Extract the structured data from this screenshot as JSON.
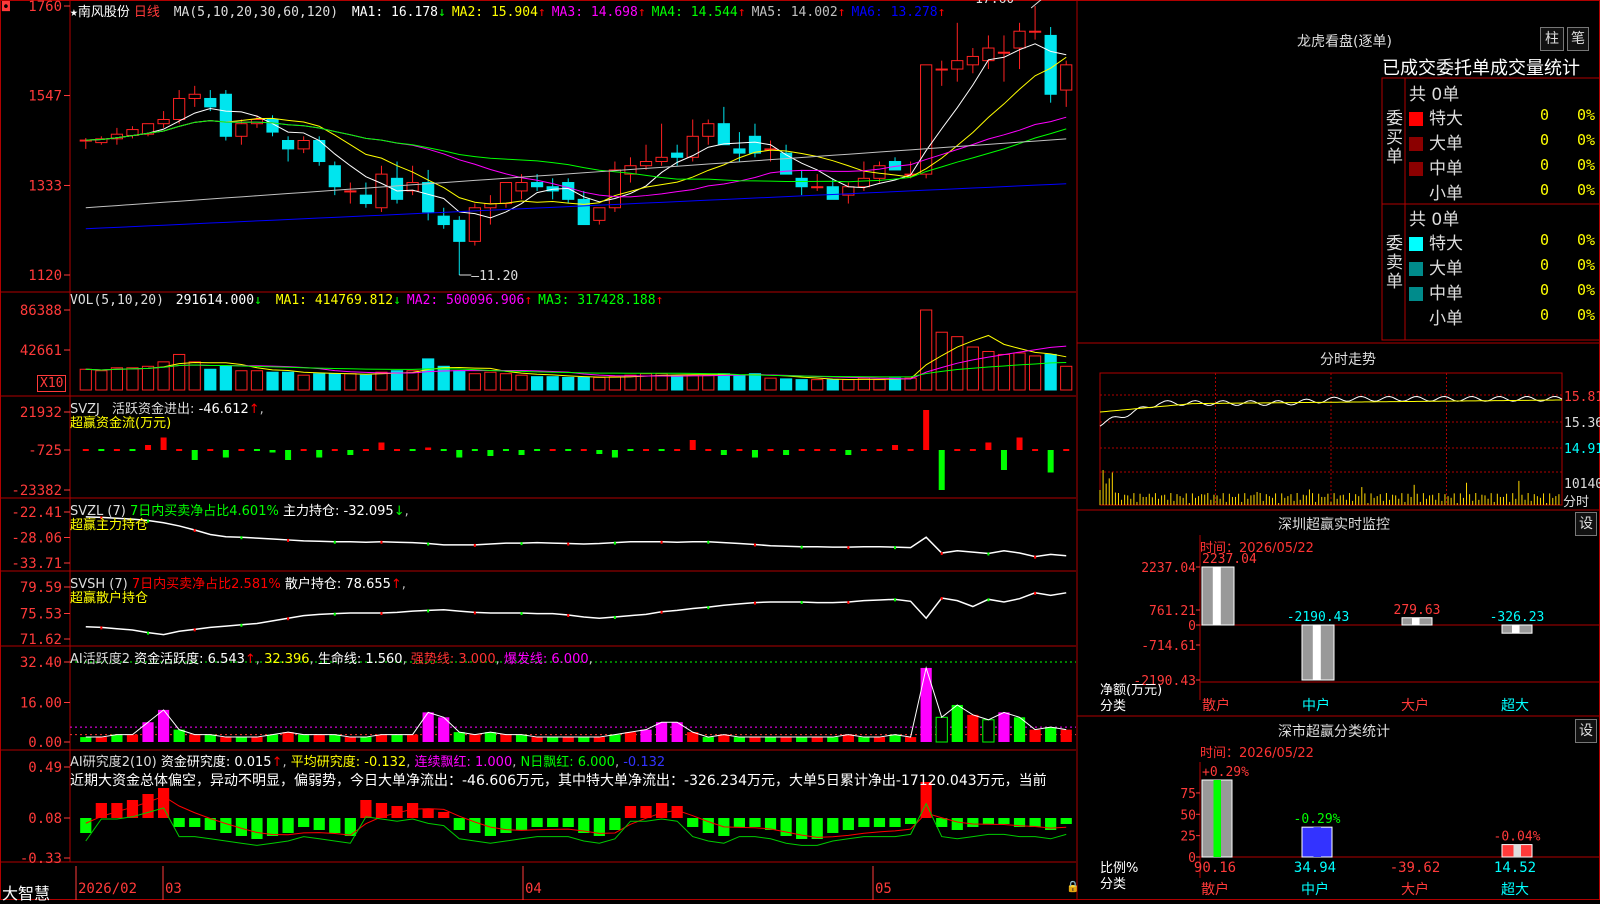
{
  "stock": {
    "star": "★",
    "name": "南风股份",
    "period": "日线"
  },
  "colors": {
    "up": "#ff2222",
    "down": "#00e5ee",
    "bg": "#000000",
    "frame": "#b00000",
    "grid": "#7a0000",
    "ma1": "#ffffff",
    "ma2": "#ffff00",
    "ma3": "#ff00ff",
    "ma4": "#00ff00",
    "ma5": "#c0c0c0",
    "ma6": "#0000ff",
    "buyBig": "#ff0000",
    "buyL": "#8b0000",
    "sellBig": "#00ffff",
    "sellL": "#008b8b"
  },
  "main": {
    "ma_label": "MA(5,10,20,30,60,120)",
    "ma": [
      {
        "label": "MA1:",
        "value": "16.178",
        "arrow": "↓",
        "color": "#ffffff"
      },
      {
        "label": "MA2:",
        "value": "15.904",
        "arrow": "↑",
        "color": "#ffff00"
      },
      {
        "label": "MA3:",
        "value": "14.698",
        "arrow": "↑",
        "color": "#ff00ff"
      },
      {
        "label": "MA4:",
        "value": "14.544",
        "arrow": "↑",
        "color": "#00ff00"
      },
      {
        "label": "MA5:",
        "value": "14.002",
        "arrow": "↑",
        "color": "#c0c0c0"
      },
      {
        "label": "MA6:",
        "value": "13.278",
        "arrow": "↑",
        "color": "#0000ff"
      }
    ],
    "yticks": [
      "1760",
      "1547",
      "1333",
      "1120"
    ],
    "high_label": "17.60",
    "low_label": "11.20",
    "ylim": [
      11.2,
      17.6
    ],
    "candles": [
      [
        14.41,
        14.46,
        14.2,
        14.41
      ],
      [
        14.35,
        14.5,
        14.3,
        14.44
      ],
      [
        14.44,
        14.7,
        14.3,
        14.55
      ],
      [
        14.52,
        14.74,
        14.45,
        14.66
      ],
      [
        14.55,
        14.75,
        14.5,
        14.8
      ],
      [
        14.8,
        15.1,
        14.7,
        14.9
      ],
      [
        14.9,
        15.6,
        14.8,
        15.4
      ],
      [
        15.4,
        15.7,
        15.2,
        15.5
      ],
      [
        15.4,
        15.6,
        15.1,
        15.2
      ],
      [
        15.5,
        15.6,
        14.4,
        14.5
      ],
      [
        14.5,
        14.9,
        14.3,
        14.8
      ],
      [
        14.8,
        15.0,
        14.7,
        14.9
      ],
      [
        14.9,
        15.0,
        14.5,
        14.6
      ],
      [
        14.4,
        14.5,
        13.9,
        14.2
      ],
      [
        14.2,
        14.5,
        14.1,
        14.4
      ],
      [
        14.4,
        14.5,
        13.8,
        13.9
      ],
      [
        13.8,
        13.9,
        13.1,
        13.3
      ],
      [
        13.2,
        13.4,
        12.9,
        13.2
      ],
      [
        13.1,
        13.4,
        12.8,
        12.9
      ],
      [
        12.8,
        13.8,
        12.7,
        13.6
      ],
      [
        13.5,
        13.9,
        12.9,
        13.0
      ],
      [
        13.2,
        13.8,
        13.1,
        13.4
      ],
      [
        13.4,
        13.7,
        12.5,
        12.7
      ],
      [
        12.6,
        12.8,
        12.3,
        12.4
      ],
      [
        12.5,
        12.6,
        11.2,
        12.0
      ],
      [
        12.0,
        12.9,
        11.9,
        12.8
      ],
      [
        12.8,
        13.1,
        12.4,
        12.9
      ],
      [
        12.9,
        13.4,
        12.8,
        13.4
      ],
      [
        13.2,
        13.6,
        13.0,
        13.4
      ],
      [
        13.4,
        13.6,
        13.2,
        13.3
      ],
      [
        13.3,
        13.5,
        13.0,
        13.2
      ],
      [
        13.4,
        13.5,
        12.9,
        13.0
      ],
      [
        13.0,
        13.2,
        12.4,
        12.4
      ],
      [
        12.5,
        12.8,
        12.4,
        12.8
      ],
      [
        12.8,
        13.9,
        12.7,
        13.7
      ],
      [
        13.6,
        14.0,
        13.4,
        13.8
      ],
      [
        13.8,
        14.3,
        13.7,
        13.9
      ],
      [
        13.9,
        14.8,
        13.8,
        14.0
      ],
      [
        14.1,
        14.3,
        13.8,
        14.0
      ],
      [
        14.0,
        14.9,
        13.9,
        14.5
      ],
      [
        14.5,
        14.9,
        14.3,
        14.8
      ],
      [
        14.8,
        15.2,
        14.3,
        14.3
      ],
      [
        14.2,
        14.6,
        13.9,
        14.1
      ],
      [
        14.5,
        14.8,
        14.0,
        14.1
      ],
      [
        14.2,
        14.4,
        13.9,
        14.2
      ],
      [
        14.1,
        14.3,
        13.6,
        13.6
      ],
      [
        13.5,
        13.7,
        13.1,
        13.3
      ],
      [
        13.3,
        13.6,
        13.2,
        13.3
      ],
      [
        13.3,
        13.5,
        13.0,
        13.0
      ],
      [
        13.1,
        13.4,
        12.9,
        13.3
      ],
      [
        13.3,
        13.9,
        13.2,
        13.5
      ],
      [
        13.5,
        13.9,
        13.4,
        13.8
      ],
      [
        13.9,
        14.0,
        13.7,
        13.7
      ],
      [
        13.6,
        13.9,
        13.5,
        13.6
      ],
      [
        13.6,
        16.2,
        13.5,
        16.2
      ],
      [
        16.1,
        16.3,
        15.7,
        16.1
      ],
      [
        16.1,
        17.2,
        15.8,
        16.3
      ],
      [
        16.2,
        16.6,
        16.0,
        16.4
      ],
      [
        16.3,
        16.9,
        16.1,
        16.6
      ],
      [
        16.5,
        16.9,
        15.8,
        16.5
      ],
      [
        16.6,
        17.2,
        16.1,
        17.0
      ],
      [
        17.0,
        17.6,
        16.8,
        17.0
      ],
      [
        16.9,
        17.1,
        15.3,
        15.5
      ],
      [
        15.6,
        16.3,
        15.2,
        16.2
      ]
    ]
  },
  "vol": {
    "label": "VOL(5,10,20)",
    "value": "291614.000",
    "arrow": "↓",
    "ma": [
      {
        "label": "MA1:",
        "value": "414769.812",
        "arrow": "↓",
        "color": "#ffff00"
      },
      {
        "label": "MA2:",
        "value": "500096.906",
        "arrow": "↑",
        "color": "#ff00ff"
      },
      {
        "label": "MA3:",
        "value": "317428.188",
        "arrow": "↑",
        "color": "#00ff00"
      }
    ],
    "yticks": [
      "86388",
      "42661"
    ],
    "unit": "X10",
    "values": [
      140,
      130,
      150,
      150,
      160,
      190,
      240,
      190,
      140,
      160,
      130,
      130,
      120,
      120,
      100,
      110,
      110,
      110,
      100,
      120,
      130,
      130,
      210,
      160,
      130,
      110,
      120,
      110,
      100,
      90,
      90,
      85,
      85,
      85,
      90,
      100,
      110,
      110,
      95,
      100,
      100,
      110,
      100,
      110,
      80,
      75,
      70,
      70,
      70,
      70,
      80,
      70,
      80,
      80,
      540,
      390,
      360,
      290,
      260,
      240,
      250,
      230,
      240,
      160
    ]
  },
  "svzj": {
    "label": "SVZJ",
    "name": "活跃资金进出:",
    "value": "-46.612",
    "arrow": "↑",
    "sub": "超赢资金流(万元)",
    "yticks": [
      "21932",
      "-725",
      "-23382"
    ],
    "values": [
      0,
      0,
      0,
      0,
      10,
      25,
      0,
      -20,
      0,
      -15,
      0,
      0,
      -5,
      -20,
      0,
      -15,
      0,
      -10,
      0,
      15,
      0,
      0,
      5,
      0,
      -15,
      0,
      -12,
      0,
      -10,
      0,
      0,
      0,
      0,
      -8,
      -15,
      0,
      0,
      0,
      0,
      20,
      0,
      -10,
      0,
      -15,
      0,
      -10,
      0,
      0,
      0,
      -10,
      0,
      0,
      10,
      0,
      80,
      -80,
      0,
      0,
      15,
      -40,
      25,
      0,
      -45,
      0
    ]
  },
  "svzl": {
    "label": "SVZL (7)",
    "mid": "7日内买卖净占比4.601%",
    "main_label": "主力持仓:",
    "main_value": "-32.095",
    "arrow": "↓",
    "sub": "超赢主力持仓",
    "yticks": [
      "-22.41",
      "-28.06",
      "-33.71"
    ],
    "values": [
      -23.5,
      -23.6,
      -23.8,
      -24.0,
      -24.3,
      -24.8,
      -25.5,
      -26.4,
      -27.4,
      -27.9,
      -28.0,
      -28.2,
      -28.4,
      -28.6,
      -28.8,
      -28.9,
      -29.0,
      -29.0,
      -29.1,
      -29.0,
      -29.1,
      -29.2,
      -29.4,
      -29.7,
      -29.7,
      -29.7,
      -29.5,
      -29.3,
      -29.3,
      -29.2,
      -29.3,
      -29.4,
      -29.5,
      -29.4,
      -29.2,
      -29.0,
      -29.0,
      -29.0,
      -29.1,
      -29.0,
      -29.0,
      -29.2,
      -29.4,
      -29.6,
      -29.9,
      -30.0,
      -30.1,
      -30.1,
      -30.2,
      -30.2,
      -30.1,
      -30.1,
      -30.2,
      -30.3,
      -28.0,
      -31.5,
      -31.0,
      -31.3,
      -31.6,
      -31.0,
      -31.5,
      -32.3,
      -31.8,
      -32.1
    ]
  },
  "svsh": {
    "label": "SVSH (7)",
    "mid": "7日内买卖净占比2.581%",
    "main_label": "散户持仓:",
    "main_value": "78.655",
    "arrow": "↑",
    "sub": "超赢散户持仓",
    "yticks": [
      "79.59",
      "75.53",
      "71.62"
    ],
    "values": [
      73.5,
      73.4,
      73.2,
      73.0,
      72.6,
      72.3,
      72.8,
      73.1,
      73.4,
      73.6,
      73.8,
      74.0,
      74.4,
      74.8,
      75.2,
      75.4,
      75.5,
      75.6,
      75.6,
      75.6,
      75.7,
      75.9,
      76.0,
      76.1,
      75.9,
      75.7,
      75.6,
      75.6,
      75.6,
      75.5,
      75.5,
      75.3,
      75.0,
      74.8,
      75.0,
      75.2,
      75.4,
      75.8,
      76.0,
      76.3,
      76.5,
      76.8,
      77.0,
      77.2,
      77.3,
      77.3,
      77.3,
      77.2,
      77.2,
      77.3,
      77.5,
      77.6,
      77.7,
      77.4,
      74.8,
      77.9,
      77.5,
      76.6,
      77.7,
      77.3,
      77.8,
      78.7,
      78.3,
      78.7
    ]
  },
  "ai_act": {
    "label": "AI活跃度2",
    "name": "资金活跃度:",
    "value": "6.543",
    "arrow": "↑",
    "v2": "32.396",
    "life_label": "生命线:",
    "life": "1.560",
    "strong_label": "强势线:",
    "strong": "3.000",
    "burst_label": "爆发线:",
    "burst": "6.000",
    "yticks": [
      "32.40",
      "16.00",
      "0.00"
    ],
    "values": [
      2,
      2,
      3,
      3,
      8,
      13,
      5,
      3,
      3,
      2,
      2,
      2,
      3,
      4,
      3,
      3,
      3,
      2,
      2,
      3,
      3,
      3,
      12,
      10,
      4,
      3,
      4,
      3,
      3,
      2,
      2,
      2,
      2,
      2,
      3,
      4,
      5,
      8,
      8,
      4,
      2,
      3,
      2,
      2,
      2,
      2,
      2,
      2,
      2,
      3,
      2,
      2,
      3,
      2,
      30,
      10,
      15,
      11,
      9,
      12,
      10,
      5,
      6,
      5
    ],
    "flags": [
      0,
      0,
      0,
      0,
      1,
      1,
      0,
      0,
      0,
      0,
      0,
      0,
      0,
      0,
      0,
      0,
      0,
      0,
      0,
      0,
      0,
      0,
      1,
      1,
      0,
      0,
      0,
      0,
      0,
      0,
      0,
      0,
      0,
      0,
      0,
      0,
      1,
      1,
      1,
      0,
      0,
      0,
      0,
      0,
      0,
      0,
      0,
      0,
      0,
      0,
      0,
      0,
      0,
      0,
      1,
      0,
      0,
      0,
      1,
      1,
      0,
      0,
      0,
      0
    ]
  },
  "ai_res": {
    "label": "AI研究度2(10)",
    "name": "资金研究度:",
    "value": "0.015",
    "arrow": "↑",
    "avg_label": "平均研究度:",
    "avg": "-0.132",
    "red_label": "连续飘红:",
    "red": "1.000",
    "n_label": "N日飘红:",
    "n": "6.000",
    "last": "-0.132",
    "comment": "近期大资金总体偏空，异动不明显，偏弱势，今日大单净流出：-46.606万元，其中特大单净流出：-326.234万元，大单5日累计净出-17120.043万元，当前",
    "yticks": [
      "0.49",
      "0.08",
      "-0.33"
    ],
    "values": [
      -5,
      5,
      5,
      6,
      8,
      10,
      -3,
      -3,
      -4,
      -5,
      -6,
      -7,
      -6,
      -5,
      -3,
      -4,
      -5,
      -6,
      6,
      5,
      4,
      5,
      3,
      2,
      -4,
      -5,
      -6,
      -5,
      -4,
      -3,
      -3,
      -3,
      -5,
      -6,
      -4,
      4,
      4,
      5,
      4,
      -3,
      -5,
      -6,
      -3,
      -3,
      -4,
      -6,
      -7,
      -7,
      -5,
      -4,
      -3,
      -3,
      -3,
      -2,
      12,
      -3,
      -4,
      -3,
      -2,
      -2,
      -3,
      -3,
      -4,
      -2
    ]
  },
  "xaxis": {
    "bottom_name": "大智慧",
    "labels": [
      "2026/02",
      "03",
      "04",
      "05"
    ]
  },
  "dragon": {
    "title": "龙虎看盘(逐单)",
    "btn1": "柱",
    "btn2": "笔",
    "header": "已成交委托单成交量统计",
    "buy_side": "委买单",
    "sell_side": "委卖单",
    "buy_count": "共 0单",
    "sell_count": "共 0单",
    "buy_levels": [
      {
        "name": "特大",
        "v": "0",
        "p": "0%"
      },
      {
        "name": "大单",
        "v": "0",
        "p": "0%"
      },
      {
        "name": "中单",
        "v": "0",
        "p": "0%"
      },
      {
        "name": "小单",
        "v": "0",
        "p": "0%"
      }
    ],
    "sell_levels": [
      {
        "name": "特大",
        "v": "0",
        "p": "0%"
      },
      {
        "name": "大单",
        "v": "0",
        "p": "0%"
      },
      {
        "name": "中单",
        "v": "0",
        "p": "0%"
      },
      {
        "name": "小单",
        "v": "0",
        "p": "0%"
      }
    ]
  },
  "intraday": {
    "title": "分时走势",
    "yticks": [
      "15.81",
      "15.36",
      "14.91",
      "10140"
    ],
    "unit": "分时"
  },
  "monitor": {
    "title": "深圳超赢实时监控",
    "btn": "设",
    "time": "时间：2026/05/22",
    "yticks": [
      "2237.04",
      "761.21",
      "0",
      "-714.61",
      "-2190.43"
    ],
    "categories": [
      "散户",
      "中户",
      "大户",
      "超大"
    ],
    "values": [
      2237.04,
      -2190.43,
      279.63,
      -326.23
    ],
    "labels": [
      "2237.04",
      "-2190.43",
      "279.63",
      "-326.23"
    ],
    "ylabel": "净额(万元)",
    "xlabel": "分类",
    "ylim": [
      -2190.43,
      2237.04
    ]
  },
  "classify": {
    "title": "深市超赢分类统计",
    "btn": "设",
    "time": "时间：2026/05/22",
    "yticks": [
      "75",
      "50",
      "25",
      "0"
    ],
    "categories": [
      "散户",
      "中户",
      "大户",
      "超大"
    ],
    "pct": [
      "+0.29%",
      "-0.29%",
      "",
      "-0.04%"
    ],
    "values": [
      90.16,
      34.94,
      -39.62,
      14.52
    ],
    "labels": [
      "90.16",
      "34.94",
      "-39.62",
      "14.52"
    ],
    "ylabel": "比例%",
    "xlabel": "分类",
    "ylim": [
      0,
      90.16
    ]
  }
}
